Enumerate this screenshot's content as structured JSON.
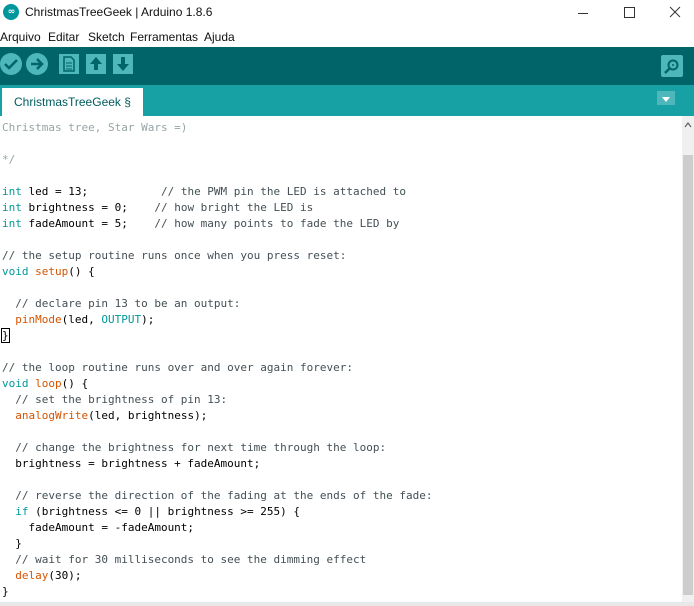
{
  "window": {
    "title": "ChristmasTreeGeek | Arduino 1.8.6",
    "app_icon_text": "∞",
    "minimize_icon": "minimize-icon",
    "maximize_icon": "maximize-icon",
    "close_icon": "close-icon"
  },
  "menu": {
    "items": [
      "Arquivo",
      "Editar",
      "Sketch",
      "Ferramentas",
      "Ajuda"
    ]
  },
  "toolbar": {
    "icons": [
      "verify-icon",
      "upload-icon",
      "new-icon",
      "open-icon",
      "save-icon",
      "serial-monitor-icon"
    ]
  },
  "tabs": {
    "active_label": "ChristmasTreeGeek §",
    "menu_icon": "tab-dropdown-icon"
  },
  "colors": {
    "toolbar": "#006468",
    "tabbar": "#17A1A5",
    "button": "#4DB7BB",
    "keyword": "#00979C",
    "function": "#D35400",
    "comment": "#434F54"
  },
  "code": {
    "l01": "Christmas tree, Star Wars =)",
    "l03": "*/",
    "l05a": "int",
    "l05b": " led = 13;           ",
    "l05c": "// the PWM pin the LED is attached to",
    "l06a": "int",
    "l06b": " brightness = 0;    ",
    "l06c": "// how bright the LED is",
    "l07a": "int",
    "l07b": " fadeAmount = 5;    ",
    "l07c": "// how many points to fade the LED by",
    "l09": "// the setup routine runs once when you press reset:",
    "l10a": "void",
    "l10b": " ",
    "l10c": "setup",
    "l10d": "() {",
    "l12": "  // declare pin 13 to be an output:",
    "l13a": "  ",
    "l13b": "pinMode",
    "l13c": "(led, ",
    "l13d": "OUTPUT",
    "l13e": ");",
    "l14": "}",
    "l16": "// the loop routine runs over and over again forever:",
    "l17a": "void",
    "l17b": " ",
    "l17c": "loop",
    "l17d": "() {",
    "l18": "  // set the brightness of pin 13:",
    "l19a": "  ",
    "l19b": "analogWrite",
    "l19c": "(led, brightness);",
    "l21": "  // change the brightness for next time through the loop:",
    "l22": "  brightness = brightness + fadeAmount;",
    "l24": "  // reverse the direction of the fading at the ends of the fade:",
    "l25a": "  ",
    "l25b": "if",
    "l25c": " (brightness <= 0 || brightness >= 255) {",
    "l26": "    fadeAmount = -fadeAmount;",
    "l27": "  }",
    "l28": "  // wait for 30 milliseconds to see the dimming effect",
    "l29a": "  ",
    "l29b": "delay",
    "l29c": "(30);",
    "l30": "}"
  }
}
